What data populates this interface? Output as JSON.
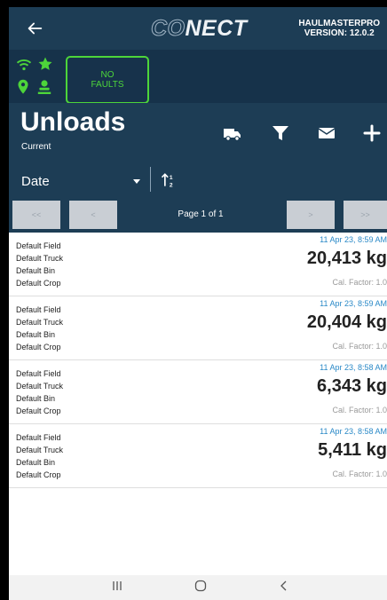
{
  "header": {
    "back_icon": "arrow-left-icon",
    "logo_co": "CO",
    "logo_nect": "NECT",
    "app_name": "HAULMASTERPRO",
    "version": "VERSION: 12.0.2"
  },
  "status": {
    "icons": [
      "wifi-icon",
      "star-icon",
      "location-pin-icon",
      "person-icon"
    ],
    "faults_label_line1": "NO",
    "faults_label_line2": "FAULTS",
    "ok_color": "#4dd53a"
  },
  "page": {
    "title": "Unloads",
    "subtitle": "Current"
  },
  "toolbar": {
    "actions": [
      "truck-icon",
      "filter-icon",
      "mail-icon",
      "plus-icon"
    ]
  },
  "sort": {
    "selected": "Date"
  },
  "pager": {
    "first": "<<",
    "prev": "<",
    "page_text": "Page 1 of 1",
    "next": ">",
    "last": ">>"
  },
  "records": [
    {
      "field": "Default Field",
      "truck": "Default Truck",
      "bin": "Default Bin",
      "crop": "Default Crop",
      "timestamp": "11 Apr 23, 8:59 AM",
      "weight": "20,413 kg",
      "cal_factor": "Cal. Factor: 1.0"
    },
    {
      "field": "Default Field",
      "truck": "Default Truck",
      "bin": "Default Bin",
      "crop": "Default Crop",
      "timestamp": "11 Apr 23, 8:59 AM",
      "weight": "20,404 kg",
      "cal_factor": "Cal. Factor: 1.0"
    },
    {
      "field": "Default Field",
      "truck": "Default Truck",
      "bin": "Default Bin",
      "crop": "Default Crop",
      "timestamp": "11 Apr 23, 8:58 AM",
      "weight": "6,343 kg",
      "cal_factor": "Cal. Factor: 1.0"
    },
    {
      "field": "Default Field",
      "truck": "Default Truck",
      "bin": "Default Bin",
      "crop": "Default Crop",
      "timestamp": "11 Apr 23, 8:58 AM",
      "weight": "5,411 kg",
      "cal_factor": "Cal. Factor: 1.0"
    }
  ],
  "nav": {
    "recents_label": "III",
    "home_label": "O",
    "back_label": "<"
  }
}
